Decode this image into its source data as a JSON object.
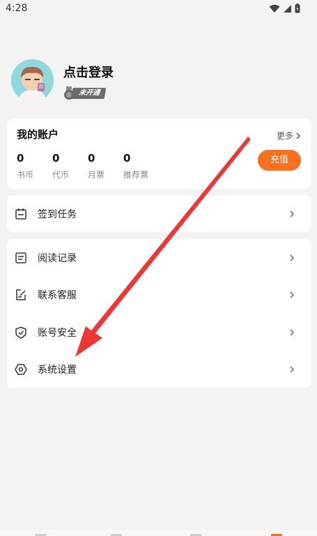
{
  "status_bar": {
    "time": "4:28"
  },
  "profile": {
    "login_label": "点击登录",
    "vip_label": "未开通"
  },
  "account": {
    "title": "我的账户",
    "more_label": "更多",
    "recharge_label": "充值",
    "stats": [
      {
        "value": "0",
        "label": "书币"
      },
      {
        "value": "0",
        "label": "代币"
      },
      {
        "value": "0",
        "label": "月票"
      },
      {
        "value": "0",
        "label": "推荐票"
      }
    ]
  },
  "menu": {
    "checkin": {
      "label": "签到任务",
      "icon": "calendar-icon"
    },
    "items": [
      {
        "label": "阅读记录",
        "icon": "history-icon"
      },
      {
        "label": "联系客服",
        "icon": "edit-icon"
      },
      {
        "label": "账号安全",
        "icon": "shield-icon"
      },
      {
        "label": "系统设置",
        "icon": "settings-icon"
      }
    ]
  },
  "colors": {
    "accent": "#f97021",
    "background": "#f3f3f3",
    "card": "#ffffff",
    "annotation_arrow": "#e31b1b"
  }
}
